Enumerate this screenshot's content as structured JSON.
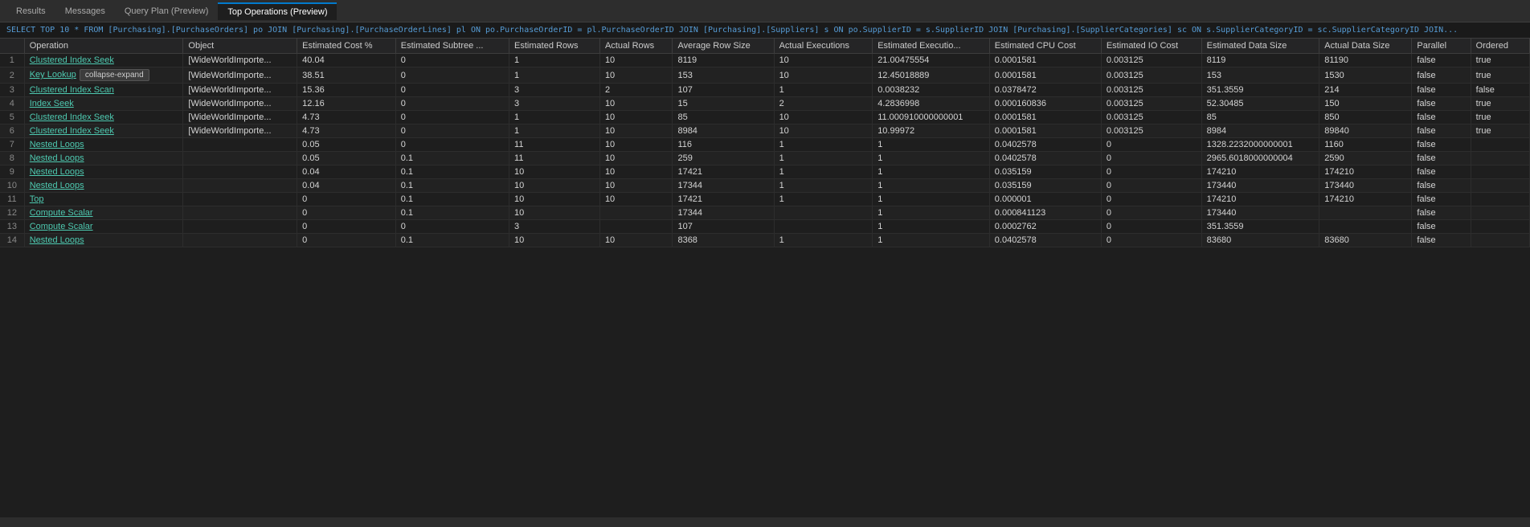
{
  "tabs": [
    {
      "label": "Results",
      "active": false
    },
    {
      "label": "Messages",
      "active": false
    },
    {
      "label": "Query Plan (Preview)",
      "active": false
    },
    {
      "label": "Top Operations (Preview)",
      "active": true
    }
  ],
  "sql": "SELECT TOP 10 * FROM [Purchasing].[PurchaseOrders] po JOIN [Purchasing].[PurchaseOrderLines] pl ON po.PurchaseOrderID = pl.PurchaseOrderID JOIN [Purchasing].[Suppliers] s ON po.SupplierID = s.SupplierID JOIN [Purchasing].[SupplierCategories] sc ON s.SupplierCategoryID = sc.SupplierCategoryID JOIN...",
  "columns": [
    "",
    "Operation",
    "Object",
    "Estimated Cost %",
    "Estimated Subtree ...",
    "Estimated Rows",
    "Actual Rows",
    "Average Row Size",
    "Actual Executions",
    "Estimated Executio...",
    "Estimated CPU Cost",
    "Estimated IO Cost",
    "Estimated Data Size",
    "Actual Data Size",
    "Parallel",
    "Ordered"
  ],
  "rows": [
    {
      "num": "1",
      "operation": "Clustered Index Seek",
      "object": "[WideWorldImporte...",
      "est_cost": "40.04",
      "est_subtree": "0",
      "est_rows": "1",
      "actual_rows": "10",
      "avg_row_size": "8119",
      "actual_exec": "10",
      "est_exec": "21.00475554",
      "est_cpu": "0.0001581",
      "est_io": "0.003125",
      "est_data_size": "8119",
      "actual_data_size": "81190",
      "parallel": "false",
      "ordered": "true"
    },
    {
      "num": "2",
      "operation": "Key Lookup",
      "object": "[WideWorldImporte...",
      "est_cost": "38.51",
      "est_subtree": "0",
      "est_rows": "1",
      "actual_rows": "10",
      "avg_row_size": "153",
      "actual_exec": "10",
      "est_exec": "12.45018889",
      "est_cpu": "0.0001581",
      "est_io": "0.003125",
      "est_data_size": "153",
      "actual_data_size": "1530",
      "parallel": "false",
      "ordered": "true",
      "has_collapse": true
    },
    {
      "num": "3",
      "operation": "Clustered Index Scan",
      "object": "[WideWorldImporte...",
      "est_cost": "15.36",
      "est_subtree": "0",
      "est_rows": "3",
      "actual_rows": "2",
      "avg_row_size": "107",
      "actual_exec": "1",
      "est_exec": "0.0038232",
      "est_cpu": "0.0378472",
      "est_io": "0.003125",
      "est_data_size": "351.3559",
      "actual_data_size": "214",
      "parallel": "false",
      "ordered": "false"
    },
    {
      "num": "4",
      "operation": "Index Seek",
      "object": "[WideWorldImporte...",
      "est_cost": "12.16",
      "est_subtree": "0",
      "est_rows": "3",
      "actual_rows": "10",
      "avg_row_size": "15",
      "actual_exec": "2",
      "est_exec": "4.2836998",
      "est_cpu": "0.000160836",
      "est_io": "0.003125",
      "est_data_size": "52.30485",
      "actual_data_size": "150",
      "parallel": "false",
      "ordered": "true"
    },
    {
      "num": "5",
      "operation": "Clustered Index Seek",
      "object": "[WideWorldImporte...",
      "est_cost": "4.73",
      "est_subtree": "0",
      "est_rows": "1",
      "actual_rows": "10",
      "avg_row_size": "85",
      "actual_exec": "10",
      "est_exec": "11.000910000000001",
      "est_cpu": "0.0001581",
      "est_io": "0.003125",
      "est_data_size": "85",
      "actual_data_size": "850",
      "parallel": "false",
      "ordered": "true"
    },
    {
      "num": "6",
      "operation": "Clustered Index Seek",
      "object": "[WideWorldImporte...",
      "est_cost": "4.73",
      "est_subtree": "0",
      "est_rows": "1",
      "actual_rows": "10",
      "avg_row_size": "8984",
      "actual_exec": "10",
      "est_exec": "10.99972",
      "est_cpu": "0.0001581",
      "est_io": "0.003125",
      "est_data_size": "8984",
      "actual_data_size": "89840",
      "parallel": "false",
      "ordered": "true"
    },
    {
      "num": "7",
      "operation": "Nested Loops",
      "object": "",
      "est_cost": "0.05",
      "est_subtree": "0",
      "est_rows": "11",
      "actual_rows": "10",
      "avg_row_size": "116",
      "actual_exec": "1",
      "est_exec": "1",
      "est_cpu": "0.0402578",
      "est_io": "0",
      "est_data_size": "1328.2232000000001",
      "actual_data_size": "1160",
      "parallel": "false",
      "ordered": ""
    },
    {
      "num": "8",
      "operation": "Nested Loops",
      "object": "",
      "est_cost": "0.05",
      "est_subtree": "0.1",
      "est_rows": "11",
      "actual_rows": "10",
      "avg_row_size": "259",
      "actual_exec": "1",
      "est_exec": "1",
      "est_cpu": "0.0402578",
      "est_io": "0",
      "est_data_size": "2965.6018000000004",
      "actual_data_size": "2590",
      "parallel": "false",
      "ordered": ""
    },
    {
      "num": "9",
      "operation": "Nested Loops",
      "object": "",
      "est_cost": "0.04",
      "est_subtree": "0.1",
      "est_rows": "10",
      "actual_rows": "10",
      "avg_row_size": "17421",
      "actual_exec": "1",
      "est_exec": "1",
      "est_cpu": "0.035159",
      "est_io": "0",
      "est_data_size": "174210",
      "actual_data_size": "174210",
      "parallel": "false",
      "ordered": ""
    },
    {
      "num": "10",
      "operation": "Nested Loops",
      "object": "",
      "est_cost": "0.04",
      "est_subtree": "0.1",
      "est_rows": "10",
      "actual_rows": "10",
      "avg_row_size": "17344",
      "actual_exec": "1",
      "est_exec": "1",
      "est_cpu": "0.035159",
      "est_io": "0",
      "est_data_size": "173440",
      "actual_data_size": "173440",
      "parallel": "false",
      "ordered": ""
    },
    {
      "num": "11",
      "operation": "Top",
      "object": "",
      "est_cost": "0",
      "est_subtree": "0.1",
      "est_rows": "10",
      "actual_rows": "10",
      "avg_row_size": "17421",
      "actual_exec": "1",
      "est_exec": "1",
      "est_cpu": "0.000001",
      "est_io": "0",
      "est_data_size": "174210",
      "actual_data_size": "174210",
      "parallel": "false",
      "ordered": ""
    },
    {
      "num": "12",
      "operation": "Compute Scalar",
      "object": "",
      "est_cost": "0",
      "est_subtree": "0.1",
      "est_rows": "10",
      "actual_rows": "",
      "avg_row_size": "17344",
      "actual_exec": "",
      "est_exec": "1",
      "est_cpu": "0.000841123",
      "est_io": "0",
      "est_data_size": "173440",
      "actual_data_size": "",
      "parallel": "false",
      "ordered": ""
    },
    {
      "num": "13",
      "operation": "Compute Scalar",
      "object": "",
      "est_cost": "0",
      "est_subtree": "0",
      "est_rows": "3",
      "actual_rows": "",
      "avg_row_size": "107",
      "actual_exec": "",
      "est_exec": "1",
      "est_cpu": "0.0002762",
      "est_io": "0",
      "est_data_size": "351.3559",
      "actual_data_size": "",
      "parallel": "false",
      "ordered": ""
    },
    {
      "num": "14",
      "operation": "Nested Loops",
      "object": "",
      "est_cost": "0",
      "est_subtree": "0.1",
      "est_rows": "10",
      "actual_rows": "10",
      "avg_row_size": "8368",
      "actual_exec": "1",
      "est_exec": "1",
      "est_cpu": "0.0402578",
      "est_io": "0",
      "est_data_size": "83680",
      "actual_data_size": "83680",
      "parallel": "false",
      "ordered": ""
    }
  ]
}
